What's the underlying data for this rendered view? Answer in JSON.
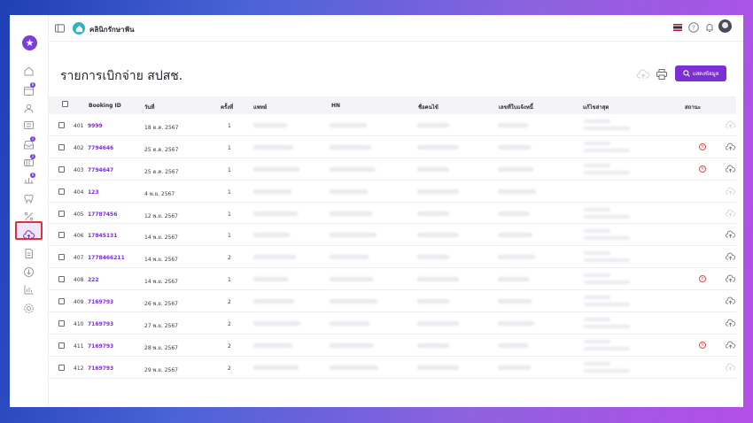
{
  "app": {
    "clinic_name": "คลินิกรักษาฟัน",
    "page_title": "รายการเบิกจ่าย สปสช.",
    "search_button": "แสดงข้อมูล",
    "brand_color": "#7b2fd6",
    "error_color": "#e54848"
  },
  "sidebar": {
    "items": [
      {
        "icon": "home-icon"
      },
      {
        "icon": "calendar-icon",
        "badge": "8"
      },
      {
        "icon": "user-icon"
      },
      {
        "icon": "id-card-icon"
      },
      {
        "icon": "inbox-icon",
        "badge": "2"
      },
      {
        "icon": "wallet-icon",
        "badge": "2"
      },
      {
        "icon": "box-icon",
        "badge": "8"
      },
      {
        "icon": "tooth-icon"
      },
      {
        "icon": "percent-icon"
      },
      {
        "icon": "cloud-icon",
        "active": true
      },
      {
        "icon": "document-icon"
      },
      {
        "icon": "download-icon"
      },
      {
        "icon": "chart-icon"
      },
      {
        "icon": "gear-icon"
      }
    ]
  },
  "table": {
    "headers": {
      "booking_id": "Booking ID",
      "date": "วันที่",
      "times": "ครั้งที่",
      "doctor": "แพทย์",
      "hn": "HN",
      "patient": "ชื่อคนไข้",
      "reference": "เลขที่ใบแจ้งหนี้",
      "updated": "แก้ไขล่าสุด",
      "status": "สถานะ"
    },
    "rows": [
      {
        "no": "401",
        "booking": "9999",
        "date": "18 ต.ค. 2567",
        "times": "1",
        "updated": true,
        "error": false,
        "upload": "disabled"
      },
      {
        "no": "402",
        "booking": "7794646",
        "date": "25 ต.ค. 2567",
        "times": "1",
        "updated": true,
        "error": true,
        "upload": "enabled"
      },
      {
        "no": "403",
        "booking": "7794647",
        "date": "25 ต.ค. 2567",
        "times": "1",
        "updated": true,
        "error": true,
        "upload": "enabled"
      },
      {
        "no": "404",
        "booking": "123",
        "date": "4 พ.ย. 2567",
        "times": "1",
        "updated": false,
        "error": false,
        "upload": "disabled"
      },
      {
        "no": "405",
        "booking": "17787456",
        "date": "12 พ.ย. 2567",
        "times": "1",
        "updated": true,
        "error": false,
        "upload": "disabled"
      },
      {
        "no": "406",
        "booking": "17845131",
        "date": "14 พ.ย. 2567",
        "times": "1",
        "updated": true,
        "error": false,
        "upload": "enabled"
      },
      {
        "no": "407",
        "booking": "1778466211",
        "date": "14 พ.ย. 2567",
        "times": "2",
        "updated": true,
        "error": false,
        "upload": "enabled"
      },
      {
        "no": "408",
        "booking": "222",
        "date": "14 พ.ย. 2567",
        "times": "1",
        "updated": true,
        "error": true,
        "upload": "enabled"
      },
      {
        "no": "409",
        "booking": "7169793",
        "date": "26 พ.ย. 2567",
        "times": "2",
        "updated": true,
        "error": false,
        "upload": "enabled"
      },
      {
        "no": "410",
        "booking": "7169793",
        "date": "27 พ.ย. 2567",
        "times": "2",
        "updated": true,
        "error": false,
        "upload": "enabled"
      },
      {
        "no": "411",
        "booking": "7169793",
        "date": "28 พ.ย. 2567",
        "times": "2",
        "updated": true,
        "error": true,
        "upload": "enabled"
      },
      {
        "no": "412",
        "booking": "7169793",
        "date": "29 พ.ย. 2567",
        "times": "2",
        "updated": true,
        "error": false,
        "upload": "disabled"
      }
    ]
  }
}
